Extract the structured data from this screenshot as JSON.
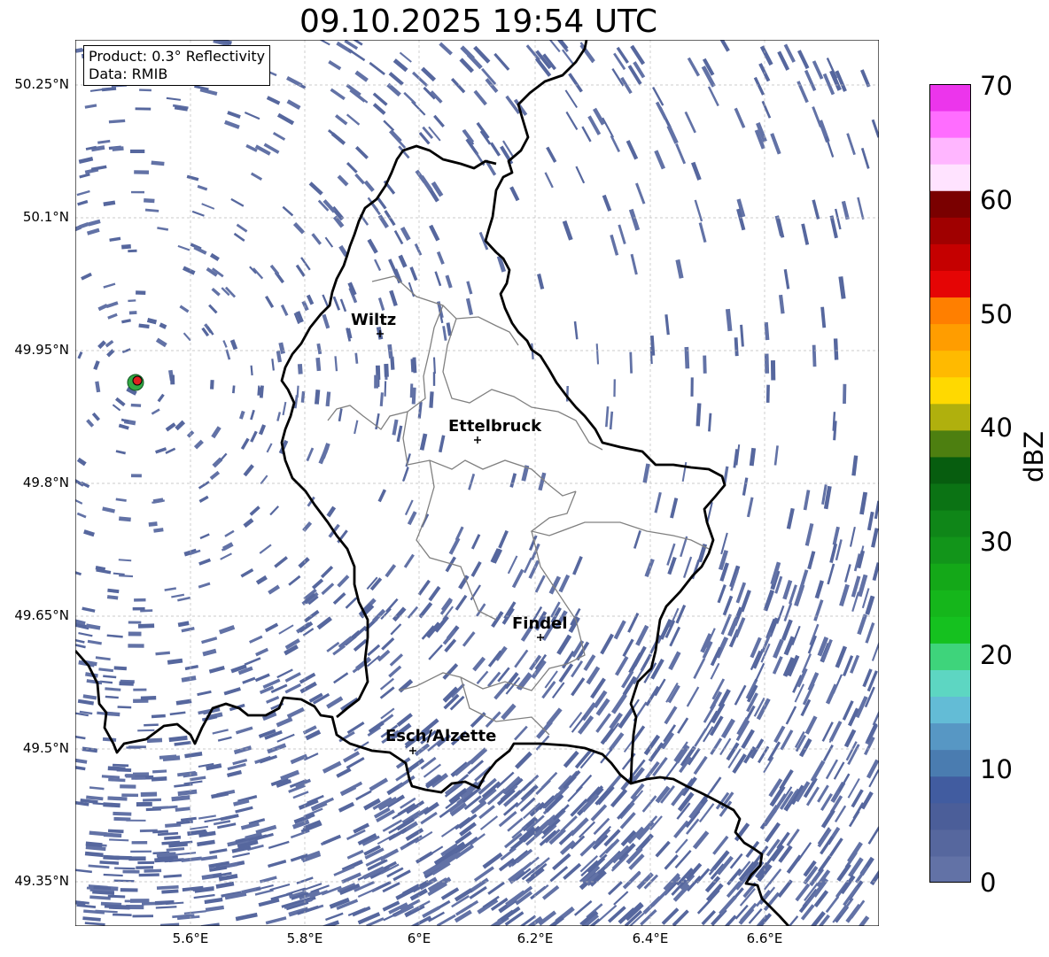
{
  "title": "09.10.2025 19:54 UTC",
  "info": {
    "product": "Product: 0.3° Reflectivity",
    "data": "Data: RMIB"
  },
  "axes": {
    "lat_ticks": [
      "50.25°N",
      "50.1°N",
      "49.95°N",
      "49.8°N",
      "49.65°N",
      "49.5°N",
      "49.35°N"
    ],
    "lon_ticks": [
      "5.6°E",
      "5.8°E",
      "6°E",
      "6.2°E",
      "6.4°E",
      "6.6°E"
    ]
  },
  "cities": [
    {
      "name": "Wiltz"
    },
    {
      "name": "Ettelbruck"
    },
    {
      "name": "Findel"
    },
    {
      "name": "Esch/Alzette"
    }
  ],
  "colorbar": {
    "label": "dBZ",
    "ticks": [
      "70",
      "60",
      "50",
      "40",
      "30",
      "20",
      "10",
      "0"
    ],
    "colors": [
      "#6272a6",
      "#56679e",
      "#4b5e99",
      "#415ca0",
      "#4a7cb0",
      "#5797c4",
      "#63bcd6",
      "#5dd6c2",
      "#3ed47b",
      "#15c11f",
      "#15b61b",
      "#14a818",
      "#12951a",
      "#0f8618",
      "#0b7314",
      "#075d0f",
      "#4d7f10",
      "#b0b00d",
      "#ffd900",
      "#ffba00",
      "#ff9d00",
      "#ff7f00",
      "#e50505",
      "#c50000",
      "#a00000",
      "#7a0000",
      "#ffe3ff",
      "#ffb6ff",
      "#ff6dff",
      "#ec35ec"
    ]
  }
}
